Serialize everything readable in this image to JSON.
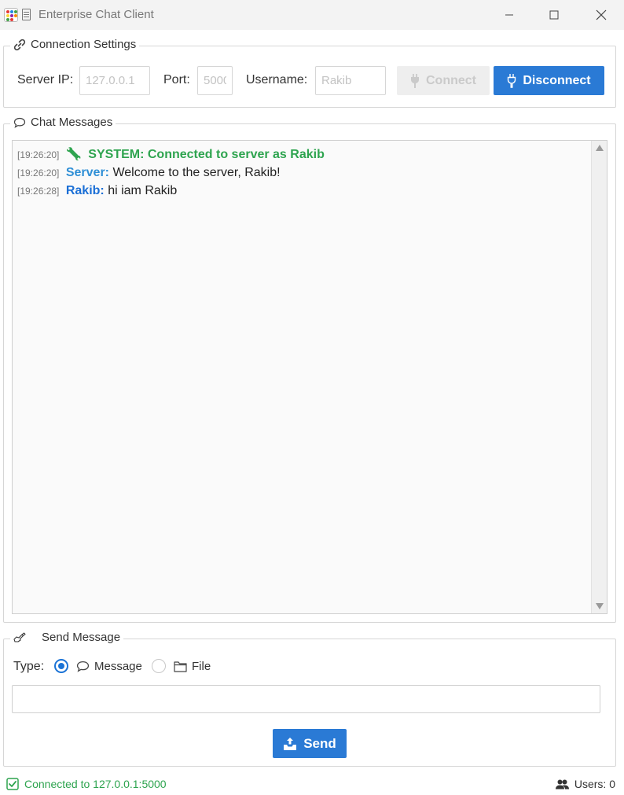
{
  "window": {
    "title": "Enterprise Chat Client"
  },
  "connection": {
    "legend": "Connection Settings",
    "server_ip_label": "Server IP:",
    "server_ip_value": "127.0.0.1",
    "port_label": "Port:",
    "port_value": "5000",
    "username_label": "Username:",
    "username_value": "Rakib",
    "connect_label": "Connect",
    "disconnect_label": "Disconnect"
  },
  "chat": {
    "legend": "Chat Messages",
    "messages": [
      {
        "time": "[19:26:20]",
        "sender": "SYSTEM:",
        "text": "Connected to server as Rakib"
      },
      {
        "time": "[19:26:20]",
        "sender": "Server:",
        "text": "Welcome to the server, Rakib!"
      },
      {
        "time": "[19:26:28]",
        "sender": "Rakib:",
        "text": "hi iam Rakib"
      }
    ]
  },
  "send": {
    "legend": "Send Message",
    "type_label": "Type:",
    "option_message": "Message",
    "option_file": "File",
    "selected": "Message",
    "input_value": "",
    "send_label": "Send"
  },
  "status": {
    "connection_text": "Connected to 127.0.0.1:5000",
    "users_text": "Users: 0"
  },
  "colors": {
    "accent": "#2a7ad5",
    "system": "#2ea44f",
    "server": "#2f8fd6",
    "user": "#1b6fd6",
    "status_ok": "#2ea44f"
  },
  "icons": {
    "connection_legend": "link-icon",
    "chat_legend": "speech-bubble-icon",
    "send_legend": "writing-hand-icon",
    "connect": "plug-icon",
    "disconnect": "plug-icon",
    "system_message": "wrench-icon",
    "message_option": "speech-bubble-icon",
    "file_option": "folder-icon",
    "send": "outbox-tray-icon",
    "status_ok": "checkbox-icon",
    "users": "users-icon"
  }
}
